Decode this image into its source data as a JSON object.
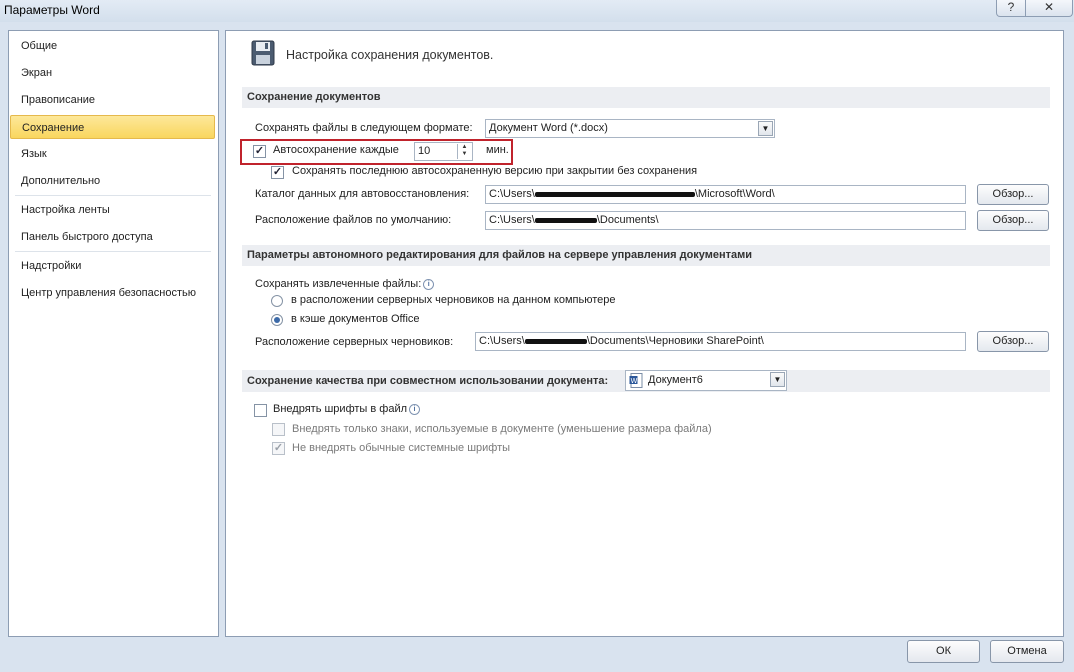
{
  "window": {
    "title": "Параметры Word",
    "help_label": "?",
    "close_label": "✕"
  },
  "nav": {
    "items": [
      {
        "label": "Общие"
      },
      {
        "label": "Экран"
      },
      {
        "label": "Правописание"
      },
      {
        "label": "Сохранение"
      },
      {
        "label": "Язык"
      },
      {
        "label": "Дополнительно"
      },
      {
        "label": "Настройка ленты"
      },
      {
        "label": "Панель быстрого доступа"
      },
      {
        "label": "Надстройки"
      },
      {
        "label": "Центр управления безопасностью"
      }
    ],
    "selected": "Сохранение"
  },
  "main": {
    "header": "Настройка сохранения документов.",
    "save_section": {
      "title": "Сохранение документов",
      "format_label": "Сохранять файлы в следующем формате:",
      "format_value": "Документ Word (*.docx)",
      "autosave_label": "Автосохранение каждые",
      "autosave_checked": true,
      "autosave_value": "10",
      "autosave_unit": "мин.",
      "keep_last_label": "Сохранять последнюю автосохраненную версию при закрытии без сохранения",
      "keep_last_checked": true,
      "autorecover_label": "Каталог данных для автовосстановления:",
      "autorecover_prefix": "C:\\Users\\",
      "autorecover_suffix": "\\Microsoft\\Word\\",
      "default_loc_label": "Расположение файлов по умолчанию:",
      "default_loc_prefix": "C:\\Users\\",
      "default_loc_suffix": "\\Documents\\",
      "browse_label": "Обзор..."
    },
    "offline_section": {
      "title": "Параметры автономного редактирования для файлов на сервере управления документами",
      "save_checked_label": "Сохранять извлеченные файлы:",
      "radio_server_label": "в расположении серверных черновиков на данном компьютере",
      "radio_cache_label": "в кэше документов Office",
      "selected_radio": "в кэше документов Office",
      "drafts_label": "Расположение серверных черновиков:",
      "drafts_prefix": "C:\\Users\\",
      "drafts_suffix": "\\Documents\\Черновики SharePoint\\",
      "browse_label": "Обзор..."
    },
    "quality_section": {
      "title": "Сохранение качества при совместном использовании документа:",
      "document_value": "Документ6",
      "embed_fonts_label": "Внедрять шрифты в файл",
      "embed_fonts_checked": false,
      "embed_chars_label": "Внедрять только знаки, используемые в документе (уменьшение размера файла)",
      "embed_chars_checked": false,
      "no_system_fonts_label": "Не внедрять обычные системные шрифты",
      "no_system_fonts_checked": true
    }
  },
  "footer": {
    "ok_label": "ОК",
    "cancel_label": "Отмена"
  },
  "icons": {
    "save": "floppy-disk-icon",
    "document": "word-document-icon",
    "info": "info-icon"
  },
  "colors": {
    "selection": "#f9d65e",
    "highlight_box": "#c0232c"
  }
}
